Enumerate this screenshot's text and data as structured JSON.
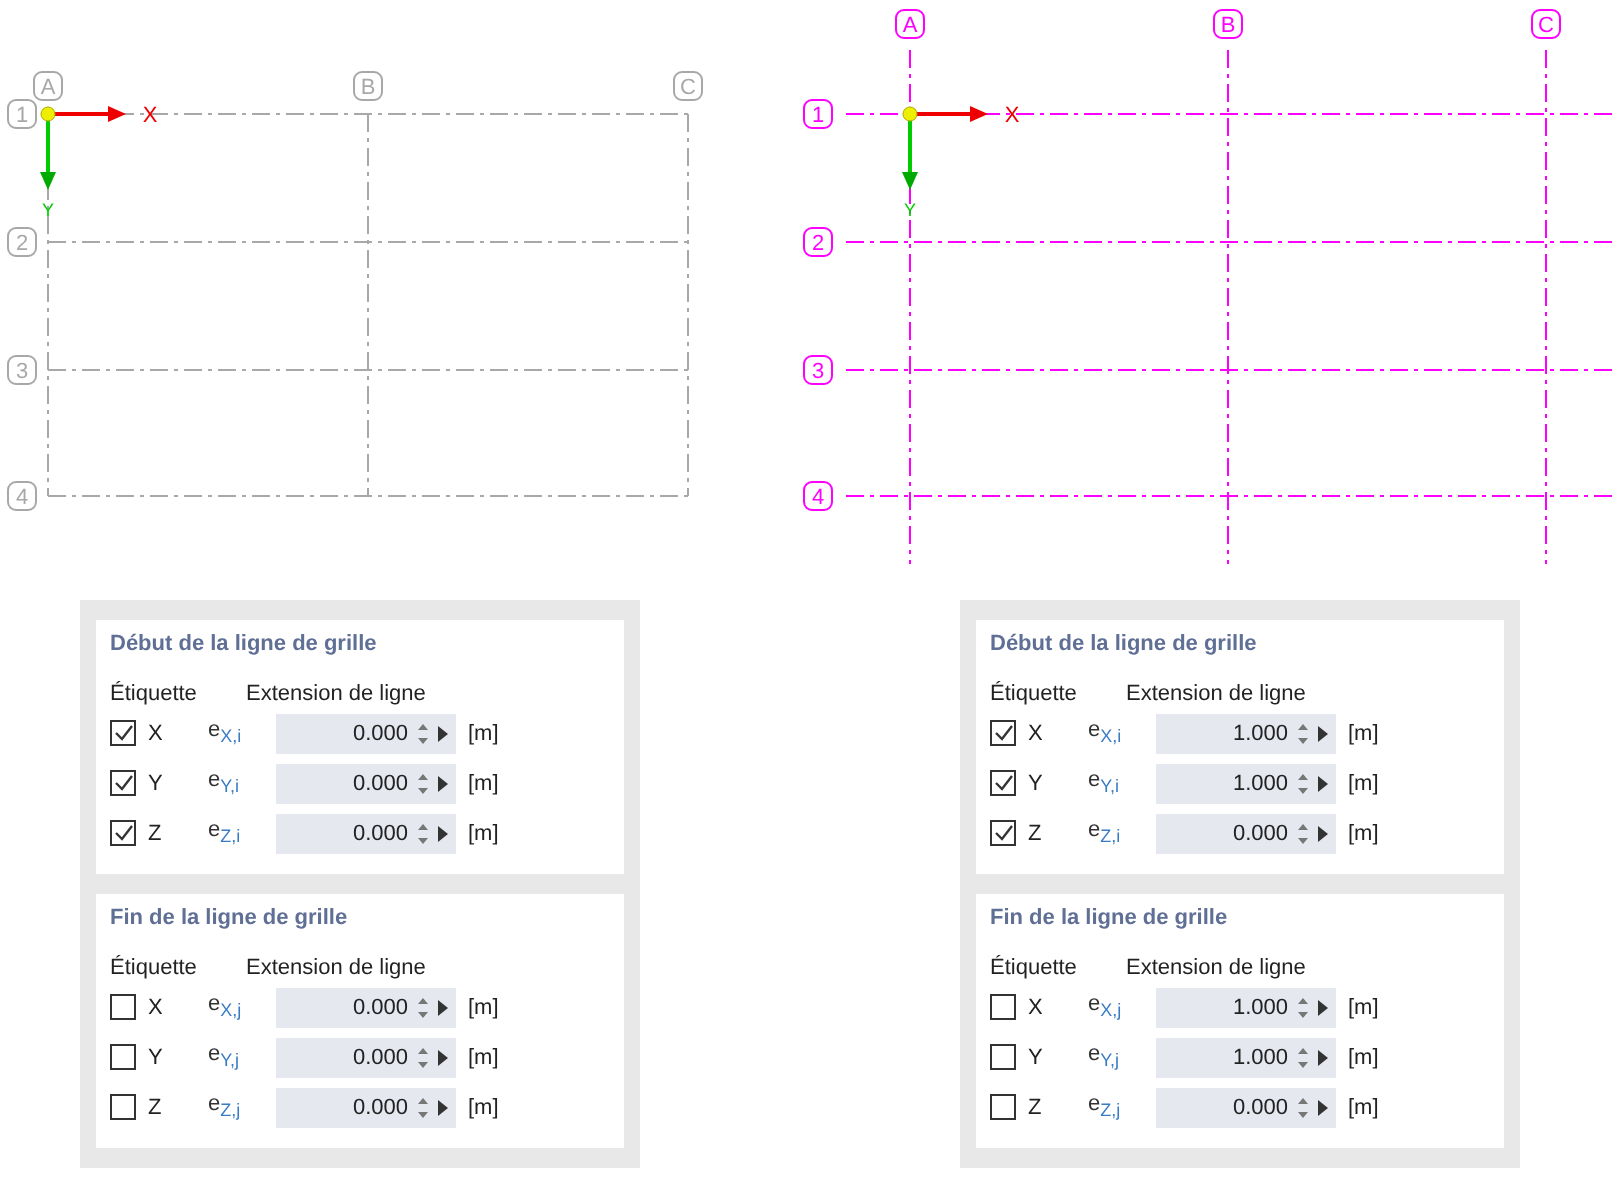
{
  "views": [
    {
      "color": "#a8a8a8",
      "extended": false,
      "columns": [
        "A",
        "B",
        "C"
      ],
      "rows": [
        "1",
        "2",
        "3",
        "4"
      ],
      "axes": {
        "x": "X",
        "y": "Y"
      },
      "panel": {
        "sections": [
          {
            "title": "Début de la ligne de grille",
            "label_header": "Étiquette",
            "extension_header": "Extension de ligne",
            "rows": [
              {
                "label": "X",
                "checked": true,
                "symbol": "e$_{X,i}$",
                "value": "0.000",
                "unit": "[m]"
              },
              {
                "label": "Y",
                "checked": true,
                "symbol": "e$_{Y,i}$",
                "value": "0.000",
                "unit": "[m]"
              },
              {
                "label": "Z",
                "checked": true,
                "symbol": "e$_{Z,i}$",
                "value": "0.000",
                "unit": "[m]"
              }
            ]
          },
          {
            "title": "Fin de la ligne de grille",
            "label_header": "Étiquette",
            "extension_header": "Extension de ligne",
            "rows": [
              {
                "label": "X",
                "checked": false,
                "symbol": "e$_{X,j}$",
                "value": "0.000",
                "unit": "[m]"
              },
              {
                "label": "Y",
                "checked": false,
                "symbol": "e$_{Y,j}$",
                "value": "0.000",
                "unit": "[m]"
              },
              {
                "label": "Z",
                "checked": false,
                "symbol": "e$_{Z,j}$",
                "value": "0.000",
                "unit": "[m]"
              }
            ]
          }
        ]
      }
    },
    {
      "color": "#ff00ff",
      "extended": true,
      "columns": [
        "A",
        "B",
        "C"
      ],
      "rows": [
        "1",
        "2",
        "3",
        "4"
      ],
      "axes": {
        "x": "X",
        "y": "Y"
      },
      "panel": {
        "sections": [
          {
            "title": "Début de la ligne de grille",
            "label_header": "Étiquette",
            "extension_header": "Extension de ligne",
            "rows": [
              {
                "label": "X",
                "checked": true,
                "symbol": "e$_{X,i}$",
                "value": "1.000",
                "unit": "[m]"
              },
              {
                "label": "Y",
                "checked": true,
                "symbol": "e$_{Y,i}$",
                "value": "1.000",
                "unit": "[m]"
              },
              {
                "label": "Z",
                "checked": true,
                "symbol": "e$_{Z,i}$",
                "value": "0.000",
                "unit": "[m]"
              }
            ]
          },
          {
            "title": "Fin de la ligne de grille",
            "label_header": "Étiquette",
            "extension_header": "Extension de ligne",
            "rows": [
              {
                "label": "X",
                "checked": false,
                "symbol": "e$_{X,j}$",
                "value": "1.000",
                "unit": "[m]"
              },
              {
                "label": "Y",
                "checked": false,
                "symbol": "e$_{Y,j}$",
                "value": "1.000",
                "unit": "[m]"
              },
              {
                "label": "Z",
                "checked": false,
                "symbol": "e$_{Z,j}$",
                "value": "0.000",
                "unit": "[m]"
              }
            ]
          }
        ]
      }
    }
  ]
}
